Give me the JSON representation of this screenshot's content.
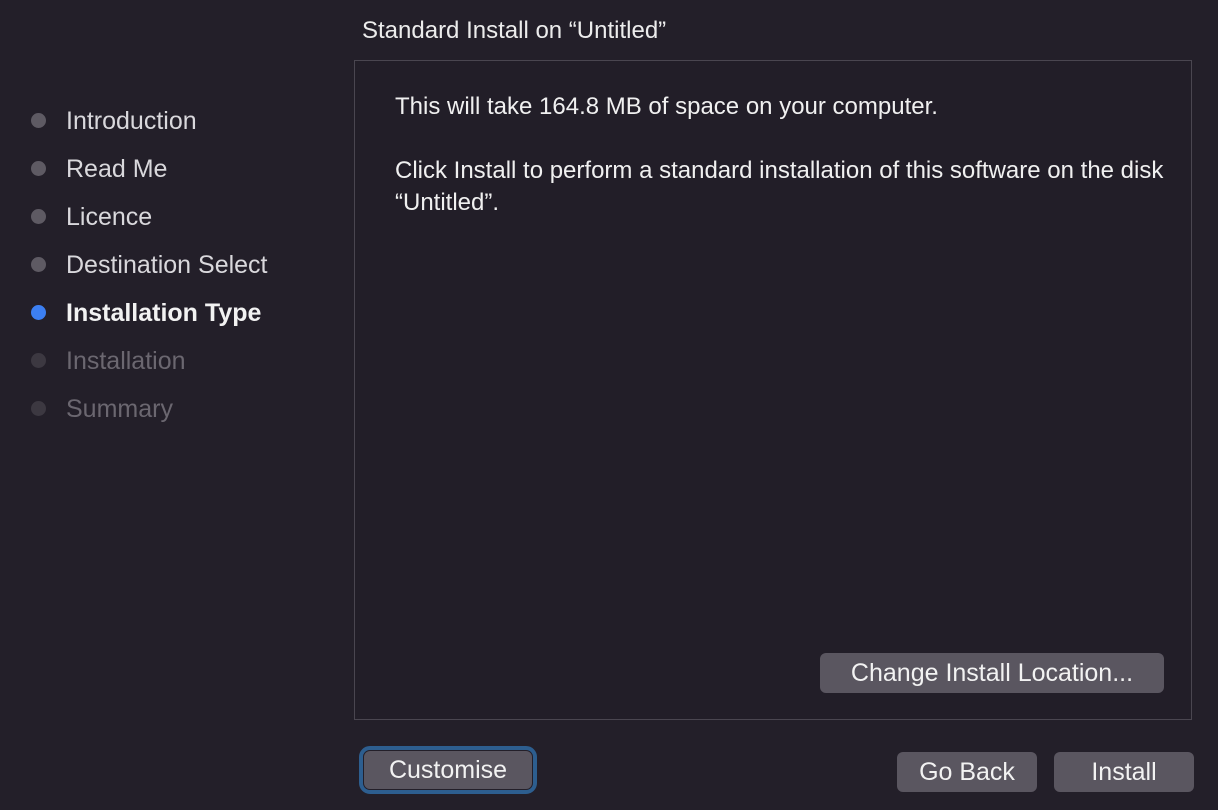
{
  "pane": {
    "title": "Standard Install on “Untitled”"
  },
  "steps": [
    {
      "label": "Introduction",
      "state": "done"
    },
    {
      "label": "Read Me",
      "state": "done"
    },
    {
      "label": "Licence",
      "state": "done"
    },
    {
      "label": "Destination Select",
      "state": "done"
    },
    {
      "label": "Installation Type",
      "state": "current"
    },
    {
      "label": "Installation",
      "state": "future"
    },
    {
      "label": "Summary",
      "state": "future"
    }
  ],
  "content": {
    "space_text": "This will take 164.8 MB of space on your computer.",
    "instructions_text": "Click Install to perform a standard installation of this software on the disk “Untitled”.",
    "change_location_label": "Change Install Location..."
  },
  "buttons": {
    "customise_label": "Customise",
    "go_back_label": "Go Back",
    "install_label": "Install"
  },
  "colors": {
    "background": "#231f29",
    "current_step_dot": "#3c7ff2",
    "button": "#5a5660",
    "focus_ring": "#2d5e8f"
  }
}
